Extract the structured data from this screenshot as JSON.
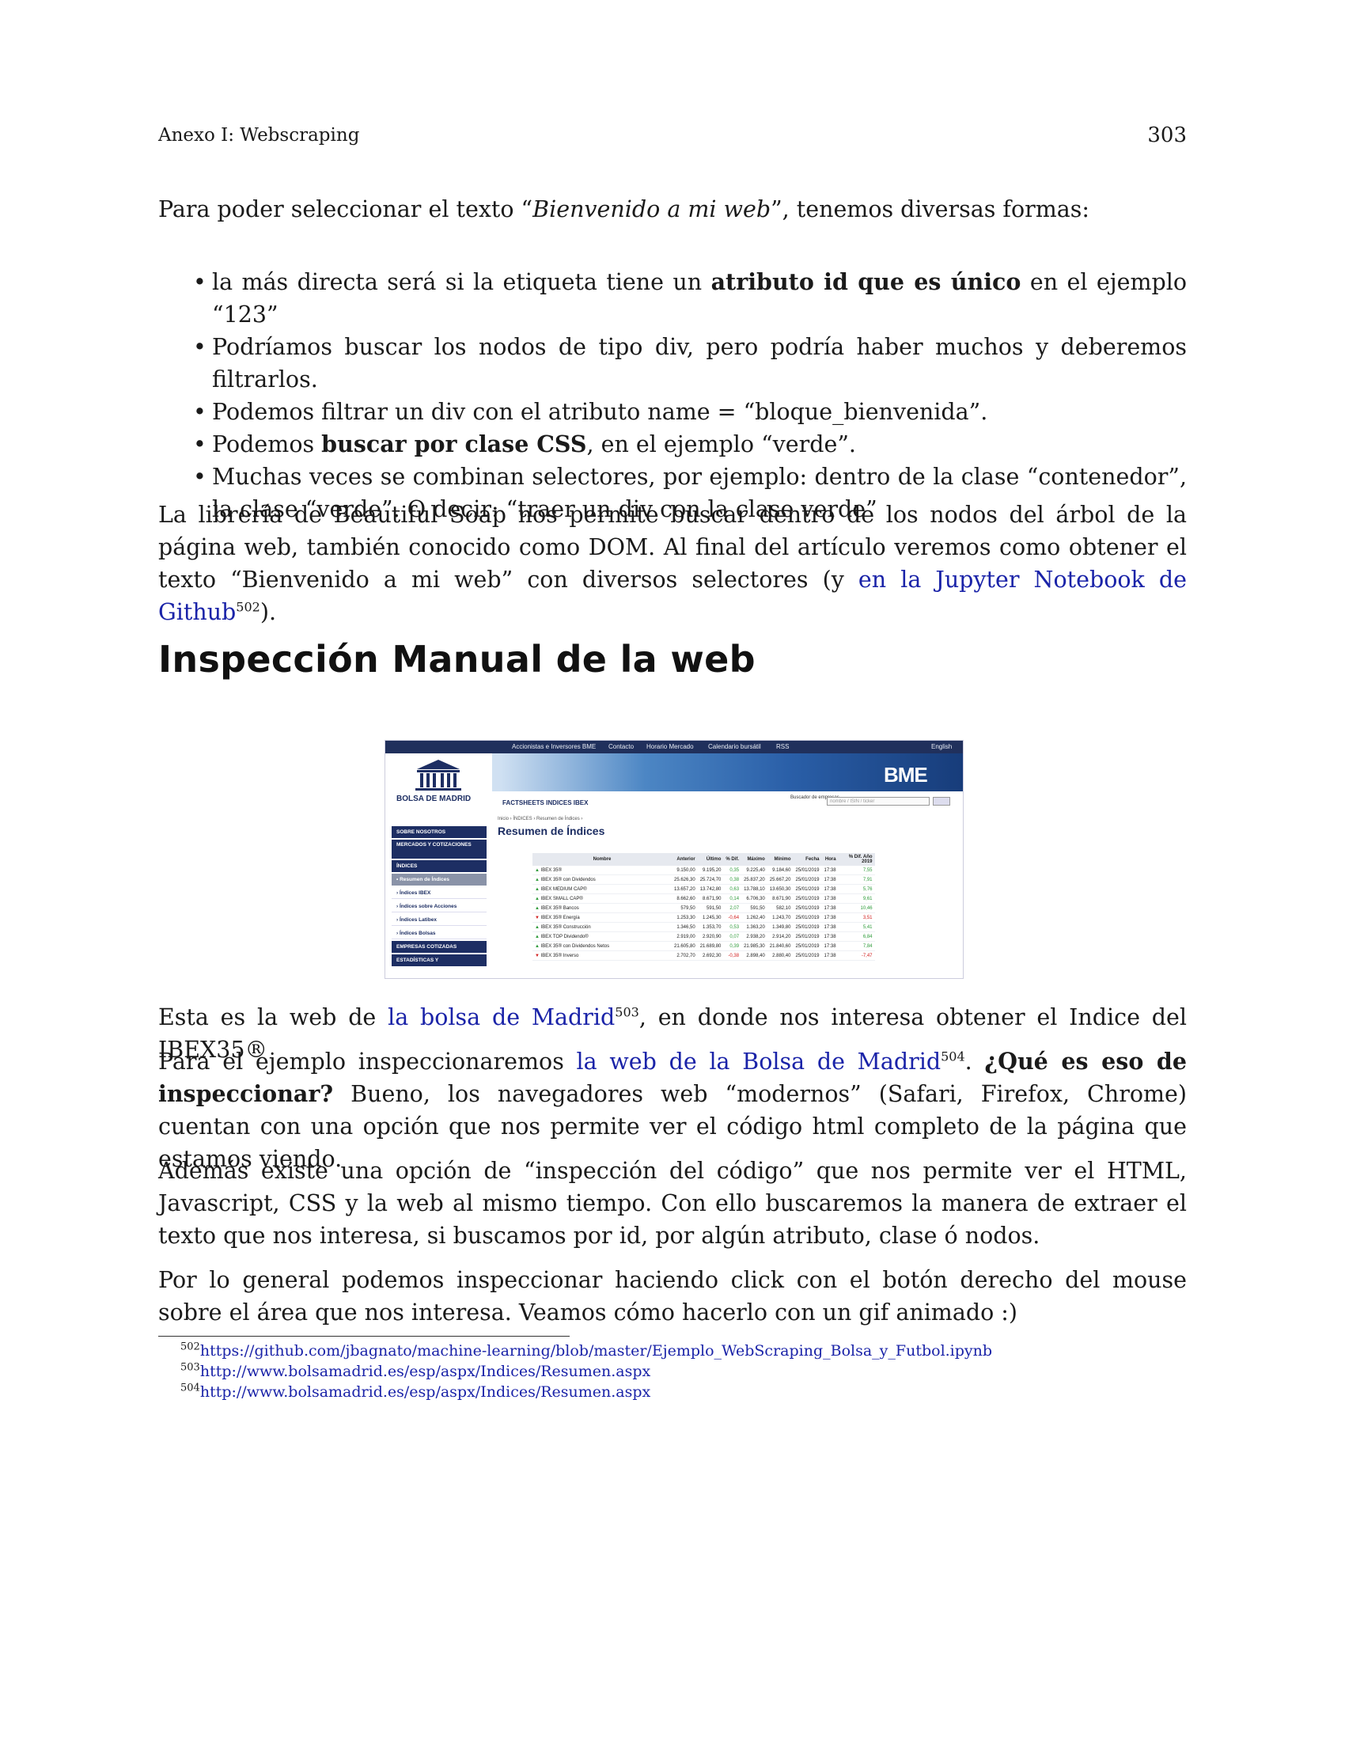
{
  "header": {
    "section_title": "Anexo I: Webscraping",
    "page_number": "303"
  },
  "intro": {
    "prefix": "Para poder seleccionar el texto “",
    "italic": "Bienvenido a mi web",
    "suffix": "”, tenemos diversas formas:"
  },
  "bullets": [
    {
      "pre": "la más directa será si la etiqueta tiene un ",
      "bold": "atributo id que es único",
      "post": " en el ejemplo “123”"
    },
    {
      "pre": "Podríamos buscar los nodos de tipo div, pero podría haber muchos y deberemos filtrarlos.",
      "bold": "",
      "post": ""
    },
    {
      "pre": "Podemos filtrar un div con el atributo name = “bloque_bienvenida”.",
      "bold": "",
      "post": ""
    },
    {
      "pre": "Podemos ",
      "bold": "buscar por clase CSS",
      "post": ", en el ejemplo “verde”."
    },
    {
      "pre": "Muchas veces se combinan selectores, por ejemplo: dentro de la clase “contenedor”, la clase “verde”. O decir: “traer un div con la clase verde”",
      "bold": "",
      "post": ""
    }
  ],
  "soup_paragraph": {
    "text": "La librería de Beautiful Soap nos permite buscar dentro de los nodos del árbol de la página web, también conocido como DOM. Al final del artículo veremos como obtener el texto “Bienvenido a mi web” con diversos selectores (y ",
    "link": "en la Jupyter Notebook de Github",
    "footnote": "502",
    "end": ")."
  },
  "section_heading": "Inspección Manual de la web",
  "screenshot": {
    "topbar_items": [
      "Accionistas e Inversores BME",
      "Contacto",
      "Horario Mercado",
      "Calendario bursátil",
      "RSS",
      "English"
    ],
    "logo": "BOLSA DE MADRID",
    "brand": "BME",
    "factsheet_title": "FACTSHEETS INDICES IBEX",
    "search_label": "Buscador de empresas",
    "search_placeholder": "nombre / ISIN / ticker",
    "breadcrumb": "Inicio › ÍNDICES › Resumen de Índices ›",
    "page_title": "Resumen de Índices",
    "sidebar": [
      "SOBRE NOSOTROS",
      "MERCADOS Y COTIZACIONES",
      "ÍNDICES",
      "• Resumen de Índices",
      "› Índices IBEX",
      "› Índices sobre Acciones",
      "› Índices Latibex",
      "› Índices Bolsas",
      "EMPRESAS COTIZADAS",
      "ESTADÍSTICAS Y"
    ],
    "columns": [
      "Nombre",
      "Anterior",
      "Último",
      "% Dif.",
      "Máximo",
      "Mínimo",
      "Fecha",
      "Hora",
      "% Dif. Año 2019"
    ],
    "rows": [
      {
        "dir": "up",
        "cells": [
          "IBEX 35®",
          "9.150,00",
          "9.195,20",
          "0,35",
          "9.225,40",
          "9.184,60",
          "25/01/2019",
          "17:38",
          "7,55"
        ]
      },
      {
        "dir": "up",
        "cells": [
          "IBEX 35® con Dividendos",
          "25.626,30",
          "25.724,70",
          "0,38",
          "25.837,20",
          "25.667,20",
          "25/01/2019",
          "17:38",
          "7,91"
        ]
      },
      {
        "dir": "up",
        "cells": [
          "IBEX MEDIUM CAP®",
          "13.657,20",
          "13.742,80",
          "0,63",
          "13.788,10",
          "13.650,30",
          "25/01/2019",
          "17:38",
          "5,76"
        ]
      },
      {
        "dir": "up",
        "cells": [
          "IBEX SMALL CAP®",
          "8.662,60",
          "8.671,90",
          "0,14",
          "6.706,30",
          "8.671,90",
          "25/01/2019",
          "17:38",
          "9,61"
        ]
      },
      {
        "dir": "up",
        "cells": [
          "IBEX 35® Bancos",
          "579,50",
          "591,50",
          "2,07",
          "591,50",
          "582,10",
          "25/01/2019",
          "17:38",
          "10,46"
        ]
      },
      {
        "dir": "dn",
        "cells": [
          "IBEX 35® Energía",
          "1.253,30",
          "1.245,30",
          "-0,64",
          "1.262,40",
          "1.243,70",
          "25/01/2019",
          "17:38",
          "3,51"
        ]
      },
      {
        "dir": "up",
        "cells": [
          "IBEX 35® Construcción",
          "1.346,50",
          "1.353,70",
          "0,53",
          "1.363,20",
          "1.349,80",
          "25/01/2019",
          "17:38",
          "5,41"
        ]
      },
      {
        "dir": "up",
        "cells": [
          "IBEX TOP Dividendo®",
          "2.919,00",
          "2.920,90",
          "0,07",
          "2.938,20",
          "2.914,20",
          "25/01/2019",
          "17:38",
          "6,84"
        ]
      },
      {
        "dir": "up",
        "cells": [
          "IBEX 35® con Dividendos Netos",
          "21.605,80",
          "21.689,80",
          "0,39",
          "21.985,30",
          "21.840,60",
          "25/01/2019",
          "17:38",
          "7,84"
        ]
      },
      {
        "dir": "dn",
        "cells": [
          "IBEX 35® Inverso",
          "2.702,70",
          "2.692,30",
          "-0,38",
          "2.898,40",
          "2.880,40",
          "25/01/2019",
          "17:38",
          "-7,47"
        ]
      }
    ]
  },
  "para_web": {
    "pre": "Esta es la web de ",
    "link": "la bolsa de Madrid",
    "footnote": "503",
    "post": ", en donde nos interesa obtener el Indice del IBEX35®"
  },
  "para_example": {
    "pre": "Para el ejemplo inspeccionaremos ",
    "link": "la web de la Bolsa de Madrid",
    "footnote": "504",
    "mid": ". ",
    "bold": "¿Qué es eso de inspeccionar?",
    "post": " Bueno, los navegadores web “modernos” (Safari, Firefox, Chrome) cuentan con una opción que nos permite ver el código html completo de la página que estamos viendo."
  },
  "para_inspect": "Además existe una opción de “inspección del código” que nos permite ver el HTML, Javascript, CSS y la web al mismo tiempo. Con ello buscaremos la manera de extraer el texto que nos interesa, si buscamos por id, por algún atributo, clase ó nodos.",
  "para_general": "Por lo general podemos inspeccionar haciendo click con el botón derecho del mouse sobre el área que nos interesa. Veamos cómo hacerlo con un gif animado :)",
  "footnotes": [
    {
      "num": "502",
      "url": "https://github.com/jbagnato/machine-learning/blob/master/Ejemplo_WebScraping_Bolsa_y_Futbol.ipynb"
    },
    {
      "num": "503",
      "url": "http://www.bolsamadrid.es/esp/aspx/Indices/Resumen.aspx"
    },
    {
      "num": "504",
      "url": "http://www.bolsamadrid.es/esp/aspx/Indices/Resumen.aspx"
    }
  ],
  "colors": {
    "link": "#1a23a8",
    "text": "#1a1a1a",
    "bme_navy": "#1d2e63",
    "positive": "#2e9b3a",
    "negative": "#d22020"
  }
}
